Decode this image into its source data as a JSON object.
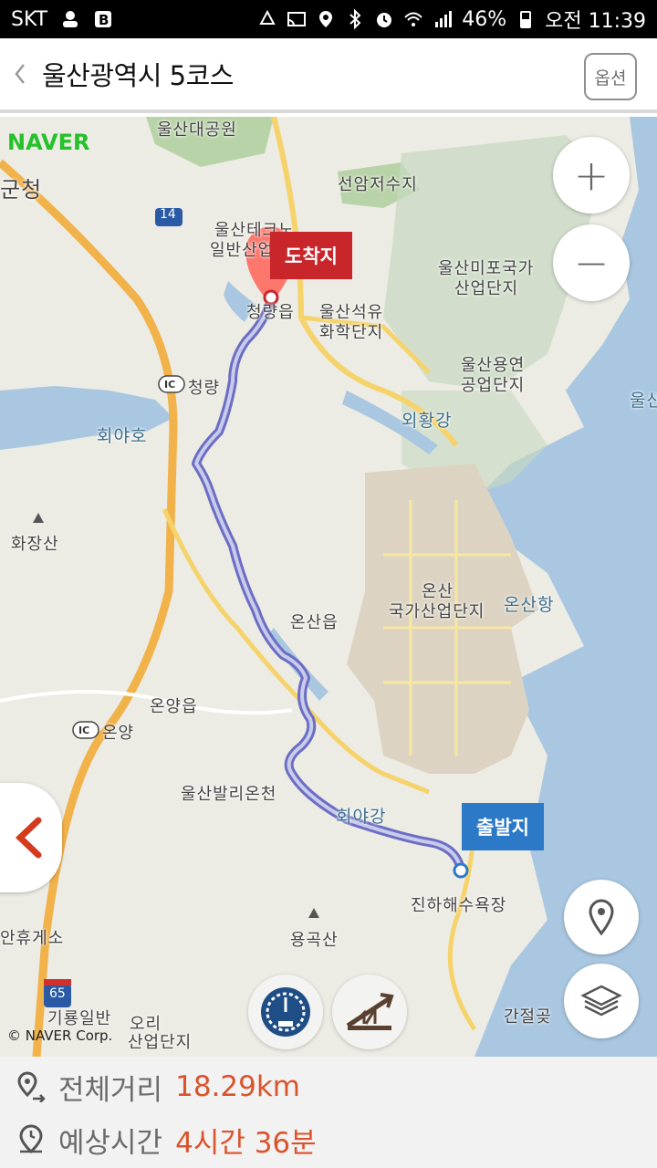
{
  "status_bar": {
    "carrier": "SKT",
    "battery": "46%",
    "time": "오전 11:39"
  },
  "header": {
    "back_icon": "chevron-left-icon",
    "title": "울산광역시 5코스",
    "options_label": "옵션"
  },
  "map": {
    "brand": "NAVER",
    "copyright": "© NAVER Corp.",
    "labels": {
      "l1": "울산대공원",
      "l2": "군청",
      "l3": "선암저수지",
      "l4": "울산테크노",
      "l5": "일반산업단지",
      "l6": "울산미포국가",
      "l7": "산업단지",
      "l8": "울산석유",
      "l9": "화학단지",
      "l10": "청량읍",
      "l11": "청량",
      "l12": "회야호",
      "l13": "울산용연",
      "l14": "공업단지",
      "l15": "외황강",
      "l16": "화장산",
      "l17": "온산",
      "l18": "국가산업단지",
      "l19": "온산항",
      "l20": "온산읍",
      "l21": "온양읍",
      "l22": "온양",
      "l23": "울산발리온천",
      "l24": "회야강",
      "l25": "진하해수욕장",
      "l26": "안휴게소",
      "l27": "용곡산",
      "l28": "기룡일반",
      "l29": "오리",
      "l30": "산업단지",
      "l31": "간절곶",
      "l32": "울산",
      "l33": "14",
      "l34": "65"
    },
    "end_flag": "도착지",
    "start_flag": "출발지",
    "zoom_in": "+",
    "zoom_out": "−"
  },
  "info": {
    "distance_label": "전체거리",
    "distance_value": "18.29km",
    "time_label": "예상시간",
    "time_value": "4시간 36분"
  },
  "colors": {
    "route": "#4a4fa8",
    "end_flag": "#c9262c",
    "start_flag": "#2c79c8",
    "value_text": "#d9542c",
    "sea": "#a9c7e0"
  }
}
